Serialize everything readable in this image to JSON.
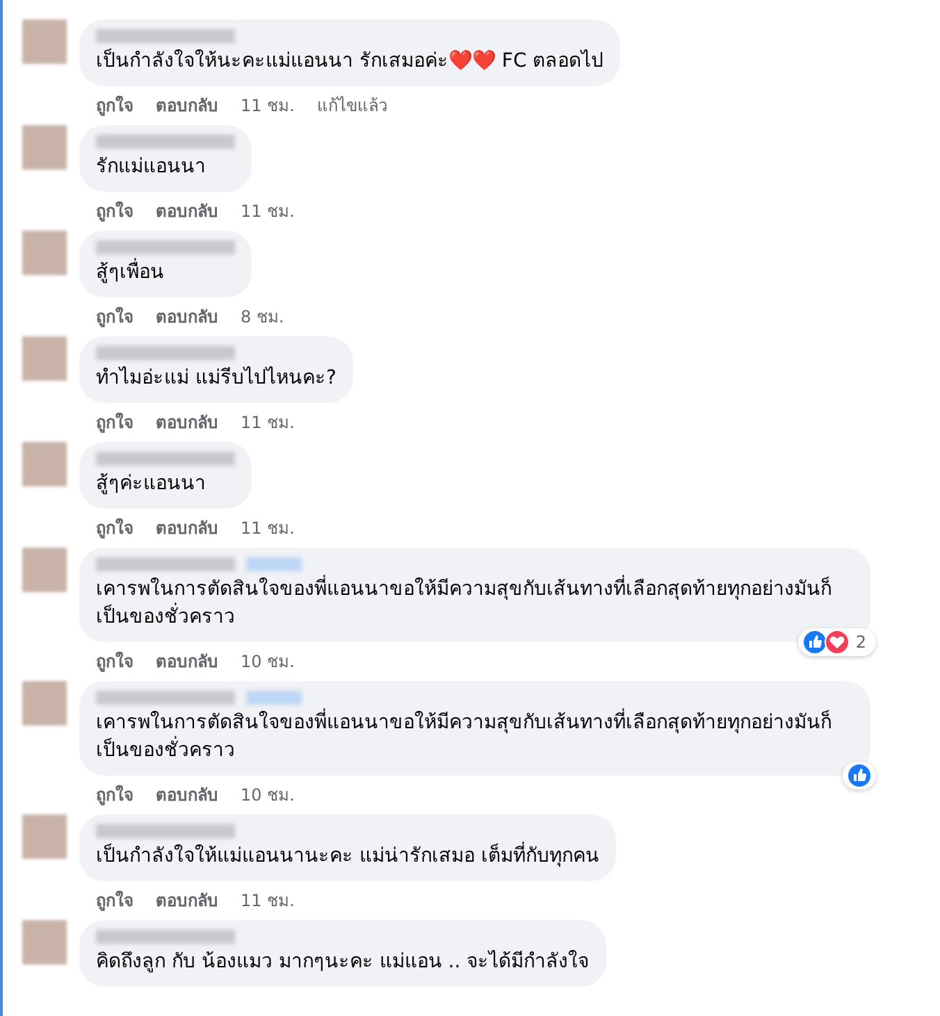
{
  "comments": [
    {
      "tagged": false,
      "text": "เป็นกำลังใจให้นะคะแม่แอนนา รักเสมอค่ะ❤️❤️ FC ตลอดไป",
      "like": "ถูกใจ",
      "reply": "ตอบกลับ",
      "time": "11 ชม.",
      "edited": "แก้ไขแล้ว"
    },
    {
      "tagged": false,
      "text": "รักแม่แอนนา",
      "like": "ถูกใจ",
      "reply": "ตอบกลับ",
      "time": "11 ชม."
    },
    {
      "tagged": false,
      "text": "สู้ๆเพื่อน",
      "like": "ถูกใจ",
      "reply": "ตอบกลับ",
      "time": "8 ชม."
    },
    {
      "tagged": false,
      "text": "ทำไมอ่ะแม่ แม่รีบไปไหนคะ?",
      "like": "ถูกใจ",
      "reply": "ตอบกลับ",
      "time": "11 ชม."
    },
    {
      "tagged": false,
      "text": "สู้ๆค่ะแอนนา",
      "like": "ถูกใจ",
      "reply": "ตอบกลับ",
      "time": "11 ชม."
    },
    {
      "tagged": true,
      "text": "เคารพในการตัดสินใจของพี่แอนนาขอให้มีความสุขกับเส้นทางที่เลือกสุดท้ายทุกอย่างมันก็เป็นของชั่วคราว",
      "like": "ถูกใจ",
      "reply": "ตอบกลับ",
      "time": "10 ชม.",
      "reactions": [
        {
          "kind": "like"
        },
        {
          "kind": "love"
        }
      ],
      "reaction_count": "2"
    },
    {
      "tagged": true,
      "text": "เคารพในการตัดสินใจของพี่แอนนาขอให้มีความสุขกับเส้นทางที่เลือกสุดท้ายทุกอย่างมันก็เป็นของชั่วคราว",
      "like": "ถูกใจ",
      "reply": "ตอบกลับ",
      "time": "10 ชม.",
      "reactions": [
        {
          "kind": "like"
        }
      ]
    },
    {
      "tagged": false,
      "text": "เป็นกำลังใจให้แม่แอนนานะคะ แม่น่ารักเสมอ เต็มที่กับทุกคน",
      "like": "ถูกใจ",
      "reply": "ตอบกลับ",
      "time": "11 ชม."
    },
    {
      "tagged": false,
      "text": "คิดถึงลูก กับ น้องแมว มากๆนะคะ แม่แอน .. จะได้มีกำลังใจ"
    }
  ]
}
